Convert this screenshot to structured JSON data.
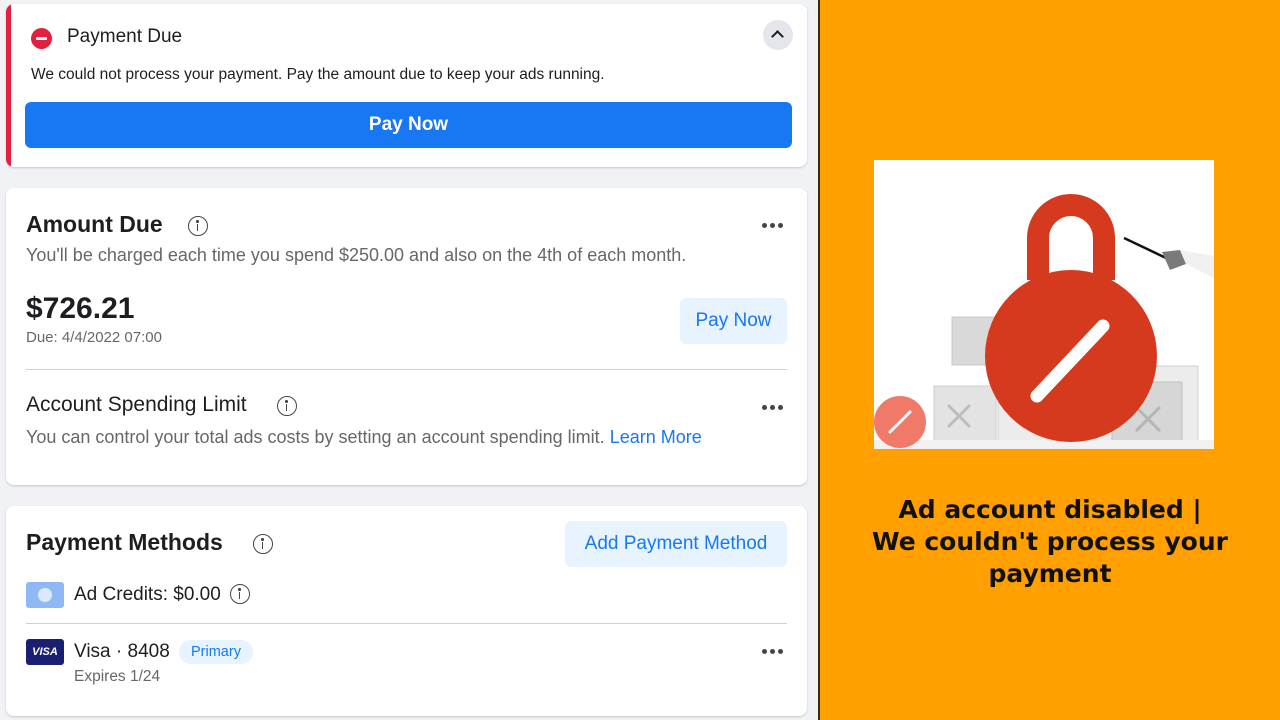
{
  "alert": {
    "title": "Payment Due",
    "message": "We could not process your payment. Pay the amount due to keep your ads running.",
    "pay_now_label": "Pay Now",
    "accent_color": "#e41e3f"
  },
  "amount_due": {
    "title": "Amount Due",
    "description": "You'll be charged each time you spend $250.00 and also on the 4th of each month.",
    "amount": "$726.21",
    "due_date": "Due: 4/4/2022 07:00",
    "pay_now_label": "Pay Now"
  },
  "spending_limit": {
    "title": "Account Spending Limit",
    "description": "You can control your total ads costs by setting an account spending limit.",
    "link_label": "Learn More"
  },
  "payment_methods": {
    "title": "Payment Methods",
    "add_label": "Add Payment Method",
    "ad_credits": "Ad Credits: $0.00",
    "card_brand": "VISA",
    "card_name": "Visa · 8408",
    "card_badge": "Primary",
    "card_expiry": "Expires 1/24"
  },
  "caption": {
    "line1": "Ad account disabled |",
    "line2": "We couldn't process your payment"
  },
  "colors": {
    "brand_blue": "#1877f2",
    "panel_orange": "#ff9f00",
    "lock_red": "#d63a1e"
  }
}
